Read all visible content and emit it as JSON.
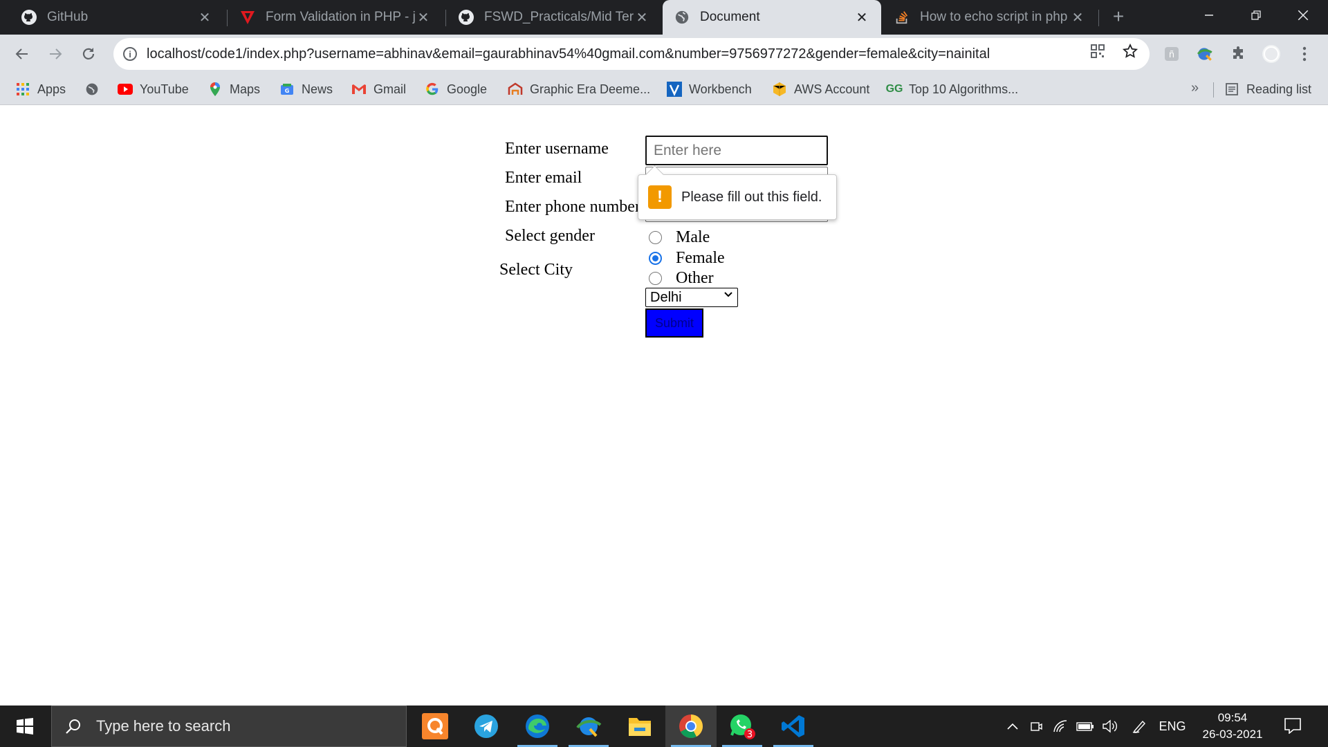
{
  "browser": {
    "tabs": [
      {
        "title": "GitHub",
        "icon": "github-icon",
        "active": false
      },
      {
        "title": "Form Validation in PHP - ja",
        "icon": "javatpoint-icon",
        "active": false
      },
      {
        "title": "FSWD_Practicals/Mid Term",
        "icon": "github-icon",
        "active": false
      },
      {
        "title": "Document",
        "icon": "globe-icon",
        "active": true
      },
      {
        "title": "How to echo script in php",
        "icon": "stackoverflow-icon",
        "active": false
      }
    ],
    "close_glyph": "✕",
    "new_tab_glyph": "+",
    "url": "localhost/code1/index.php?username=abhinav&email=gaurabhinav54%40gmail.com&number=9756977272&gender=female&city=nainital",
    "bookmarks": [
      {
        "label": "Apps",
        "icon": "apps-grid-icon"
      },
      {
        "label": "",
        "icon": "globe-icon"
      },
      {
        "label": "YouTube",
        "icon": "youtube-icon"
      },
      {
        "label": "Maps",
        "icon": "maps-pin-icon"
      },
      {
        "label": "News",
        "icon": "news-icon"
      },
      {
        "label": "Gmail",
        "icon": "gmail-icon"
      },
      {
        "label": "Google",
        "icon": "google-icon"
      },
      {
        "label": "Graphic Era Deeme...",
        "icon": "graphic-era-icon"
      },
      {
        "label": "Workbench",
        "icon": "workbench-icon"
      },
      {
        "label": "AWS Account",
        "icon": "aws-icon"
      },
      {
        "label": "Top 10 Algorithms...",
        "icon": "geeksforgeeks-icon"
      }
    ],
    "more_bookmarks": "»",
    "reading_list": "Reading list"
  },
  "form": {
    "username_label": "Enter username",
    "username_placeholder": "Enter here",
    "email_label": "Enter email",
    "phone_label": "Enter phone number",
    "gender_label": "Select gender",
    "gender_options": [
      {
        "label": "Male",
        "checked": false
      },
      {
        "label": "Female",
        "checked": true
      },
      {
        "label": "Other",
        "checked": false
      }
    ],
    "city_label": "Select City",
    "city_selected": "Delhi",
    "submit_label": "Submit",
    "validation_message": "Please fill out this field.",
    "warning_glyph": "!"
  },
  "taskbar": {
    "search_placeholder": "Type here to search",
    "apps": [
      "qbittorrent-icon",
      "telegram-icon",
      "edge-icon",
      "photos-icon",
      "file-explorer-icon",
      "chrome-icon",
      "whatsapp-icon",
      "vscode-icon"
    ],
    "whatsapp_badge": "3",
    "language": "ENG",
    "time": "09:54",
    "date": "26-03-2021"
  },
  "colors": {
    "submit_bg": "#0000ff",
    "radio_accent": "#1a73e8",
    "warning": "#f29900",
    "tabstrip": "#202124",
    "toolbar": "#dee1e6"
  }
}
